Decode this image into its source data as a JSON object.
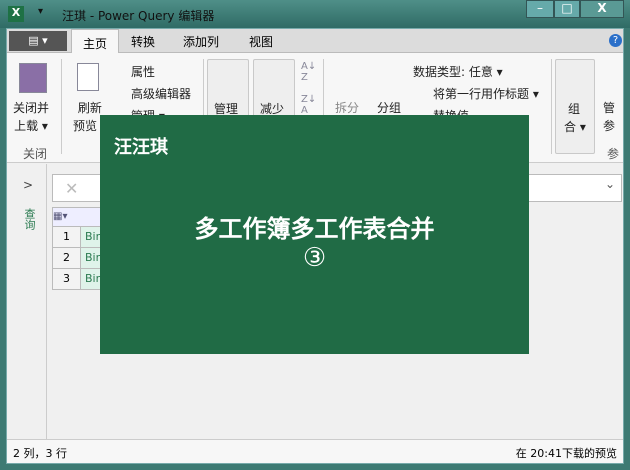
{
  "window": {
    "title": "汪琪 - Power Query 编辑器",
    "minimize": "–",
    "maximize": "□",
    "close": "X",
    "app_icon": "X"
  },
  "tabs": [
    "主页",
    "转换",
    "添加列",
    "视图"
  ],
  "file_menu": "▤ ▾",
  "help": "?",
  "ribbon": {
    "close_load": [
      "关闭并",
      "上载 ▾"
    ],
    "close_group": "关闭",
    "refresh": [
      "刷新",
      "预览 ▾"
    ],
    "properties": "属性",
    "advanced_editor": "高级编辑器",
    "manage": "管理 ▾",
    "manage_cols": "管理",
    "reduce_rows": "减少",
    "split": "拆分",
    "group_by": "分组",
    "data_type": "数据类型: 任意 ▾",
    "first_row_header": "将第一行用作标题 ▾",
    "replace_values": "替换值",
    "combine": [
      "组",
      "合 ▾"
    ],
    "params": [
      "管",
      "参"
    ],
    "params_group": "参"
  },
  "nav": {
    "expand": ">",
    "label": "查询"
  },
  "formula": {
    "cancel": "✕",
    "dropdown": "⌄"
  },
  "table": {
    "rows": [
      {
        "n": "1",
        "v": "Bin"
      },
      {
        "n": "2",
        "v": "Bin"
      },
      {
        "n": "3",
        "v": "Bin"
      }
    ]
  },
  "status": {
    "left": "2 列，3 行",
    "right": "在 20:41下载的预览"
  },
  "overlay": {
    "author": "汪汪琪",
    "title": "多工作簿多工作表合并",
    "number": "③"
  }
}
